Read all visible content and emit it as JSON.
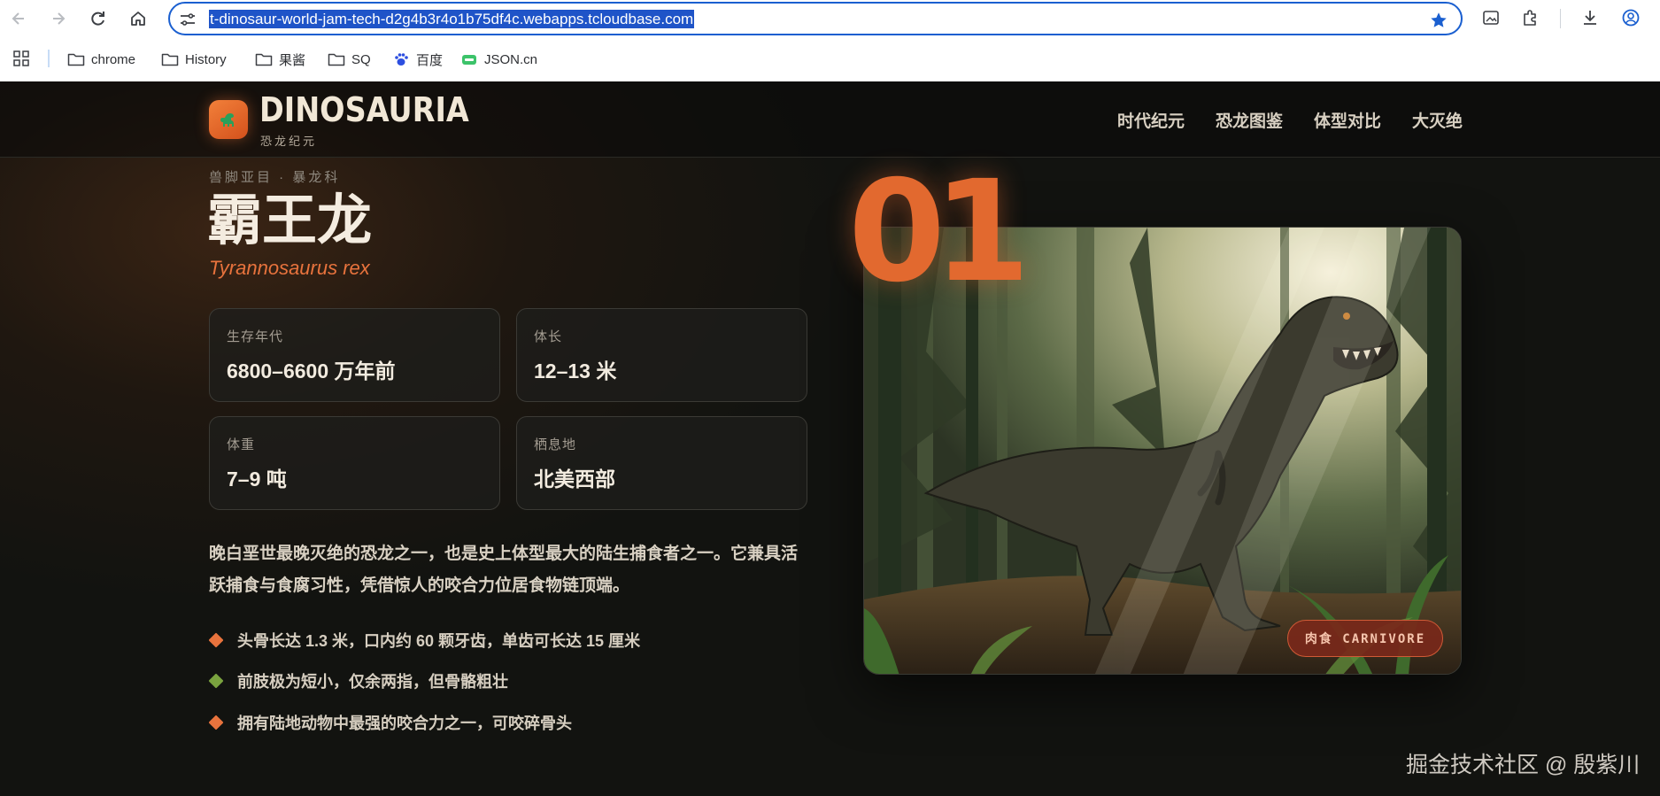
{
  "browser": {
    "url": "t-dinosaur-world-jam-tech-d2g4b3r4o1b75df4c.webapps.tcloudbase.com",
    "bookmarks": [
      {
        "label": "chrome",
        "icon": "folder-icon"
      },
      {
        "label": "History",
        "icon": "folder-icon"
      },
      {
        "label": "果酱",
        "icon": "folder-icon"
      },
      {
        "label": "SQ",
        "icon": "folder-icon"
      },
      {
        "label": "百度",
        "icon": "baidu-paw-icon"
      },
      {
        "label": "JSON.cn",
        "icon": "json-icon"
      }
    ],
    "accent": "#1a5fd0"
  },
  "site": {
    "logo_title": "DINOSAURIA",
    "logo_subtitle": "恐龙纪元",
    "nav": [
      "时代纪元",
      "恐龙图鉴",
      "体型对比",
      "大灭绝"
    ],
    "accent": "#e2692f"
  },
  "dino": {
    "taxonomy": "兽脚亚目 · 暴龙科",
    "name_cn": "霸王龙",
    "name_latin": "Tyrannosaurus rex",
    "stats": [
      {
        "label": "生存年代",
        "value": "6800–6600 万年前"
      },
      {
        "label": "体长",
        "value": "12–13 米"
      },
      {
        "label": "体重",
        "value": "7–9 吨"
      },
      {
        "label": "栖息地",
        "value": "北美西部"
      }
    ],
    "description": "晚白垩世最晚灭绝的恐龙之一，也是史上体型最大的陆生捕食者之一。它兼具活跃捕食与食腐习性，凭借惊人的咬合力位居食物链顶端。",
    "facts": [
      {
        "text": "头骨长达 1.3 米，口内约 60 颗牙齿，单齿可长达 15 厘米",
        "color": "#e8733d"
      },
      {
        "text": "前肢极为短小，仅余两指，但骨骼粗壮",
        "color": "#7aa33f"
      },
      {
        "text": "拥有陆地动物中最强的咬合力之一，可咬碎骨头",
        "color": "#e8733d"
      }
    ],
    "index_number": "01",
    "diet_badge": "肉食 CARNIVORE"
  },
  "watermark": "掘金技术社区 @ 殷紫川"
}
